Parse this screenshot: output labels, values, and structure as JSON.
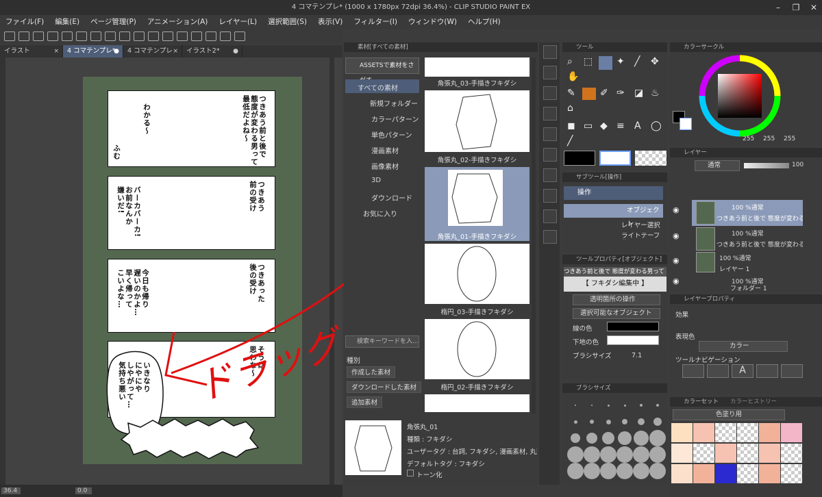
{
  "window": {
    "title": "4 コマテンプレ* (1000 x 1780px 72dpi 36.4%) - CLIP STUDIO PAINT EX"
  },
  "menu": [
    "ファイル(F)",
    "編集(E)",
    "ページ管理(P)",
    "アニメーション(A)",
    "レイヤー(L)",
    "選択範囲(S)",
    "表示(V)",
    "フィルター(I)",
    "ウィンドウ(W)",
    "ヘルプ(H)"
  ],
  "tabs": [
    {
      "label": "イラスト",
      "state": "×"
    },
    {
      "label": "4 コマテンプレ*",
      "state": "●"
    },
    {
      "label": "4 コマテンプレ",
      "state": "×"
    },
    {
      "label": "イラスト2*",
      "state": "●"
    }
  ],
  "canvas": {
    "panel1": {
      "right": "つきあう前と後で\n態度が変わる男って\n最低だよね～",
      "mid": "わかる～",
      "left": "ふむ"
    },
    "panel2": {
      "right": "つきあう\n前の受け",
      "left": "バーカバーカ!\nお前なんか\n嫌いだ!"
    },
    "panel3": {
      "right": "つきあった\n後の受け",
      "left": "今日も帰り\n遅いのかよ…\n早く帰って\nこいよな…"
    },
    "panel4": {
      "right": "そうは\n思わな～",
      "bubble": "いきなり\nにやにや\nしやがって…\n気持ち悪い"
    },
    "drag_text": "ドラッグ"
  },
  "status": {
    "zoom": "36.4",
    "angle": "0.0"
  },
  "materials": {
    "header": "素材[すべての素材]",
    "assets_button": "ASSETSで素材をさがす",
    "tree": [
      "すべての素材",
      "新規フォルダー",
      "カラーパターン",
      "単色パターン",
      "漫画素材",
      "画像素材",
      "3D",
      "ダウンロード",
      "お気に入り"
    ],
    "items": [
      "角張丸_03-手描きフキダシ",
      "角張丸_02-手描きフキダシ",
      "角張丸_01-手描きフキダシ",
      "楕円_03-手描きフキダシ",
      "楕円_02-手描きフキダシ"
    ],
    "search_placeholder": "検索キーワードを入...",
    "kind_label": "種別",
    "kinds": [
      "作成した素材",
      "ダウンロードした素材",
      "追加素材"
    ],
    "detail": {
      "name": "角張丸_01",
      "kind": "種類 : フキダシ",
      "user_tag": "ユーザータグ : 台詞, フキダシ, 漫画素材, 丸形",
      "default_tag": "デフォルトタグ : フキダシ",
      "tone": "トーン化"
    }
  },
  "tool_panel": {
    "header": "ツール"
  },
  "subtool": {
    "header": "サブツール[操作]",
    "group": "操作",
    "items": [
      "オブジェクト",
      "レイヤー選択",
      "ライトテーブル"
    ]
  },
  "tool_property": {
    "header": "ツールプロパティ[オブジェクト]",
    "text": "つきあう前と後で 態度が変わる男って 最低だよね",
    "editing": "【 フキダシ編集中 】",
    "transparent": "透明箇所の操作",
    "selectable": "選択可能なオブジェクト",
    "line_color": "線の色",
    "fill_color": "下地の色",
    "brush_size": "ブラシサイズ",
    "brush_value": "7.1"
  },
  "brush_size_panel": {
    "header": "ブラシサイズ"
  },
  "color_circle": {
    "header": "カラーサークル",
    "r": "255",
    "g": "255",
    "b": "255"
  },
  "layer_panel": {
    "header": "レイヤー",
    "blend": "通常",
    "opacity": "100",
    "layers": [
      {
        "top": "100 %通常",
        "bottom": "つきあう前と後で 態度が変わる男って"
      },
      {
        "top": "100 %通常",
        "bottom": "つきあう前と後で 態度が変わる男って"
      },
      {
        "top": "100 %通常",
        "bottom": "レイヤー 1"
      },
      {
        "top": "100 %通常",
        "bottom": "フォルダー 1"
      }
    ]
  },
  "layer_property": {
    "header": "レイヤープロパティ",
    "effect": "効果",
    "express": "表現色",
    "color": "カラー",
    "navigation": "ツールナビゲーション"
  },
  "color_set": {
    "header": "カラーセット",
    "tab2": "カラーヒストリー",
    "set_name": "色塗り用"
  },
  "colors": {
    "accent": "#c00000",
    "selection": "#8a9ab8",
    "page_bg": "#54684f"
  }
}
